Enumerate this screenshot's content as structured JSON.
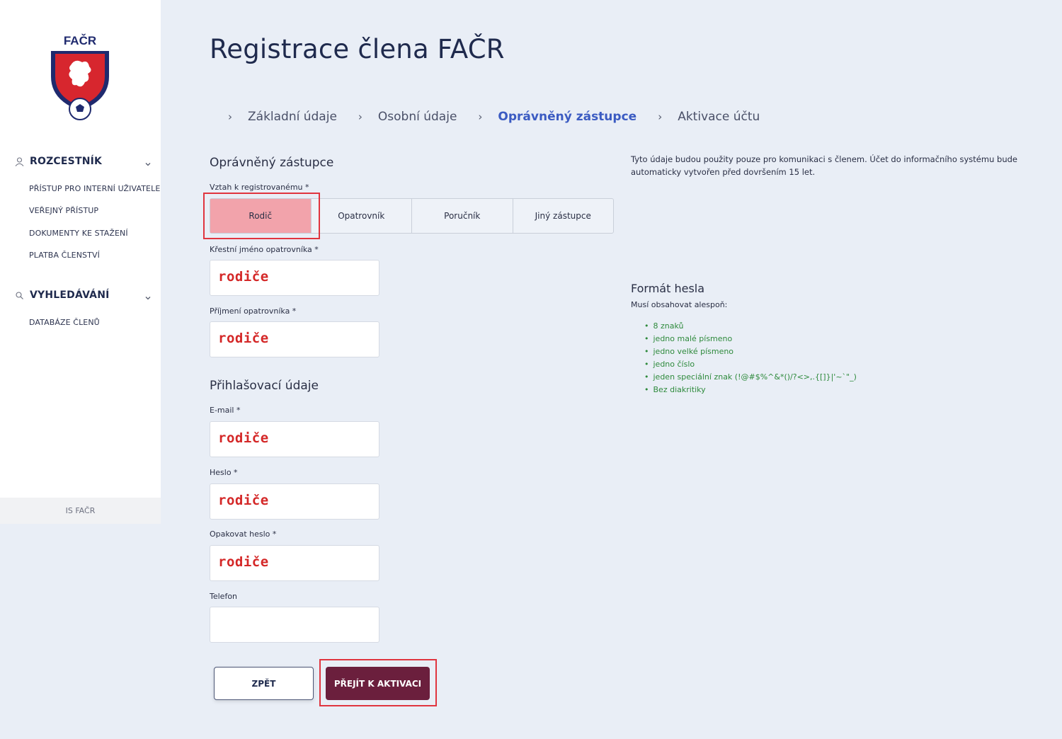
{
  "sidebar": {
    "logo_text": "FAČR",
    "sections": [
      {
        "label": "ROZCESTNÍK",
        "icon": "user-icon",
        "items": [
          "PŘÍSTUP PRO INTERNÍ UŽIVATELE",
          "VEŘEJNÝ PŘÍSTUP",
          "DOKUMENTY KE STAŽENÍ",
          "PLATBA ČLENSTVÍ"
        ]
      },
      {
        "label": "VYHLEDÁVÁNÍ",
        "icon": "search-icon",
        "items": [
          "DATABÁZE ČLENŮ"
        ]
      }
    ],
    "footer": "IS FAČR"
  },
  "page": {
    "title": "Registrace člena FAČR"
  },
  "steps": [
    {
      "label": "Základní údaje",
      "active": false
    },
    {
      "label": "Osobní údaje",
      "active": false
    },
    {
      "label": "Oprávněný zástupce",
      "active": true
    },
    {
      "label": "Aktivace účtu",
      "active": false
    }
  ],
  "form": {
    "guardian_title": "Oprávněný zástupce",
    "relation_label": "Vztah k registrovanému *",
    "relation_options": [
      "Rodič",
      "Opatrovník",
      "Poručník",
      "Jiný zástupce"
    ],
    "relation_selected": "Rodič",
    "first_name_label": "Křestní jméno opatrovníka *",
    "first_name_value": "rodiče",
    "last_name_label": "Příjmení opatrovníka *",
    "last_name_value": "rodiče",
    "login_title": "Přihlašovací údaje",
    "email_label": "E-mail *",
    "email_value": "rodiče",
    "password_label": "Heslo *",
    "password_value": "rodiče",
    "password_repeat_label": "Opakovat heslo *",
    "password_repeat_value": "rodiče",
    "phone_label": "Telefon",
    "phone_value": "",
    "back_button": "ZPĚT",
    "next_button": "PŘEJÍT K AKTIVACI"
  },
  "info": {
    "note": "Tyto údaje budou použity pouze pro komunikaci s členem. Účet do informačního systému bude automaticky vytvořen před dovršením 15 let.",
    "password_format_title": "Formát hesla",
    "password_format_subtitle": "Musí obsahovat alespoň:",
    "password_rules": [
      "8 znaků",
      "jedno malé písmeno",
      "jedno velké písmeno",
      "jedno číslo",
      "jeden speciální znak (!@#$%^&*()/?<>,.{[]}|'~`\"_)",
      "Bez diakritiky"
    ]
  },
  "colors": {
    "accent": "#3b5bc2",
    "primary_button": "#6b1f3d",
    "selected_option": "#f2a3ab",
    "highlight": "#e0353f",
    "annotation_text": "#d42727",
    "rule_text": "#2e8a3c"
  }
}
